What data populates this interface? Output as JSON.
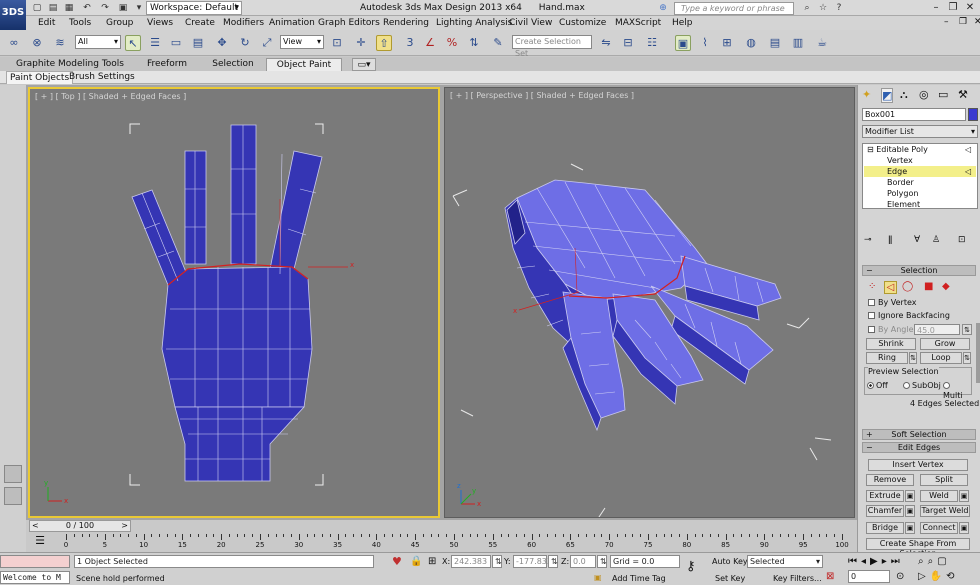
{
  "app": {
    "title": "Autodesk 3ds Max Design 2013 x64",
    "file": "Hand.max",
    "logo_text": "3DS"
  },
  "workspace": {
    "label": "Workspace: Default"
  },
  "search": {
    "placeholder": "Type a keyword or phrase"
  },
  "menus": [
    "Edit",
    "Tools",
    "Group",
    "Views",
    "Create",
    "Modifiers",
    "Animation",
    "Graph Editors",
    "Rendering",
    "Lighting Analysis",
    "Civil View",
    "Customize",
    "MAXScript",
    "Help"
  ],
  "toolbar": {
    "filter_value": "All",
    "view_value": "View",
    "selection_set_placeholder": "Create Selection Set"
  },
  "ribbon": {
    "tabs": [
      "Graphite Modeling Tools",
      "Freeform",
      "Selection",
      "Object Paint"
    ],
    "active_tab": "Object Paint",
    "subtabs": [
      "Paint Objects",
      "Brush Settings"
    ]
  },
  "viewports": {
    "top_label": "[ + ] [ Top ] [ Shaded + Edged Faces ]",
    "persp_label": "[ + ] [ Perspective ] [ Shaded + Edged Faces ]",
    "axis_x": "x",
    "axis_y": "y",
    "axis_z": "z"
  },
  "command_panel": {
    "object_name": "Box001",
    "object_color": "#3a3ad0",
    "modifier_list": "Modifier List",
    "stack": [
      "Editable Poly",
      "Vertex",
      "Edge",
      "Border",
      "Polygon",
      "Element"
    ],
    "selected_level": "Edge",
    "selection": {
      "header": "Selection",
      "by_vertex": "By Vertex",
      "ignore_backfacing": "Ignore Backfacing",
      "by_angle": "By Angle:",
      "angle_value": "45.0",
      "shrink": "Shrink",
      "grow": "Grow",
      "ring": "Ring",
      "loop": "Loop",
      "preview_selection": "Preview Selection",
      "preview_options": [
        "Off",
        "SubObj",
        "Multi"
      ],
      "preview_selected": "Off",
      "status": "4 Edges Selected"
    },
    "soft_selection": "Soft Selection",
    "edit_edges": {
      "header": "Edit Edges",
      "insert_vertex": "Insert Vertex",
      "remove": "Remove",
      "split": "Split",
      "extrude": "Extrude",
      "weld": "Weld",
      "chamfer": "Chamfer",
      "target_weld": "Target Weld",
      "bridge": "Bridge",
      "connect": "Connect",
      "create_shape": "Create Shape From Selection"
    }
  },
  "timeline": {
    "slider_label": "0 / 100",
    "ticks": [
      0,
      5,
      10,
      15,
      20,
      25,
      30,
      35,
      40,
      45,
      50,
      55,
      60,
      65,
      70,
      75,
      80,
      85,
      90,
      95,
      100
    ]
  },
  "status": {
    "maxscript_1": "Welcome to M",
    "objects_selected": "1 Object Selected",
    "prompt": "Scene hold performed",
    "x_label": "X:",
    "x_value": "242.383",
    "y_label": "Y:",
    "y_value": "-177.833",
    "z_label": "Z:",
    "z_value": "0.0",
    "grid": "Grid = 0.0",
    "add_time_tag": "Add Time Tag",
    "auto_key": "Auto Key",
    "set_key": "Set Key",
    "selected_dropdown": "Selected",
    "key_filters": "Key Filters...",
    "frame_value": "0"
  },
  "colors": {
    "mesh": "#3535b4",
    "mesh_light": "#6e6ee6",
    "viewport_bg": "#7a7a7a",
    "active_border": "#e9c935",
    "stack_highlight": "#f3ef8a"
  }
}
